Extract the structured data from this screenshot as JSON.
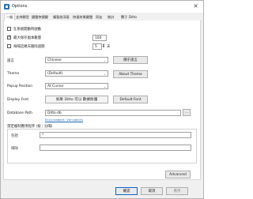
{
  "window": {
    "title": "Options",
    "close_glyph": "✕"
  },
  "tabs": [
    "一般",
    "支持類型",
    "鍵盤快捷鍵",
    "複製前深區",
    "快速材質鍵盤",
    "同友",
    "統計",
    "關于 Ditto"
  ],
  "general": {
    "start_on_login": {
      "label": "在系統開動時啟動",
      "checked": false
    },
    "max_saved": {
      "label": "最大保存副本數量",
      "checked": true,
      "value": "100"
    },
    "expire": {
      "label": "每隔這幾天刪除過期",
      "checked": false,
      "value": "5",
      "unit": "天"
    }
  },
  "rows": {
    "language": {
      "label": "語言",
      "value": "Chinese",
      "button": "關于語言"
    },
    "theme": {
      "label": "Theme",
      "value": "(Default)",
      "button": "About Theme"
    },
    "popup": {
      "label": "Popup Position",
      "value": "At Cursor"
    },
    "display_font": {
      "label": "Display Font",
      "preview": "如果 Ditto 可以 數據防護",
      "button": "Default Font"
    },
    "database": {
      "label": "Database Path",
      "value": "Ditto.db",
      "browse": "...",
      "link": "Environment Variables"
    }
  },
  "copy_group": {
    "title": "禁定複制應用程序 (按 ; 分隔)",
    "include": {
      "label": "包括",
      "value": "*"
    },
    "exclude": {
      "label": "排除",
      "value": ""
    }
  },
  "advanced_button": "Advanced",
  "footer": {
    "ok": "確認",
    "cancel": "取消",
    "apply": "應用"
  }
}
